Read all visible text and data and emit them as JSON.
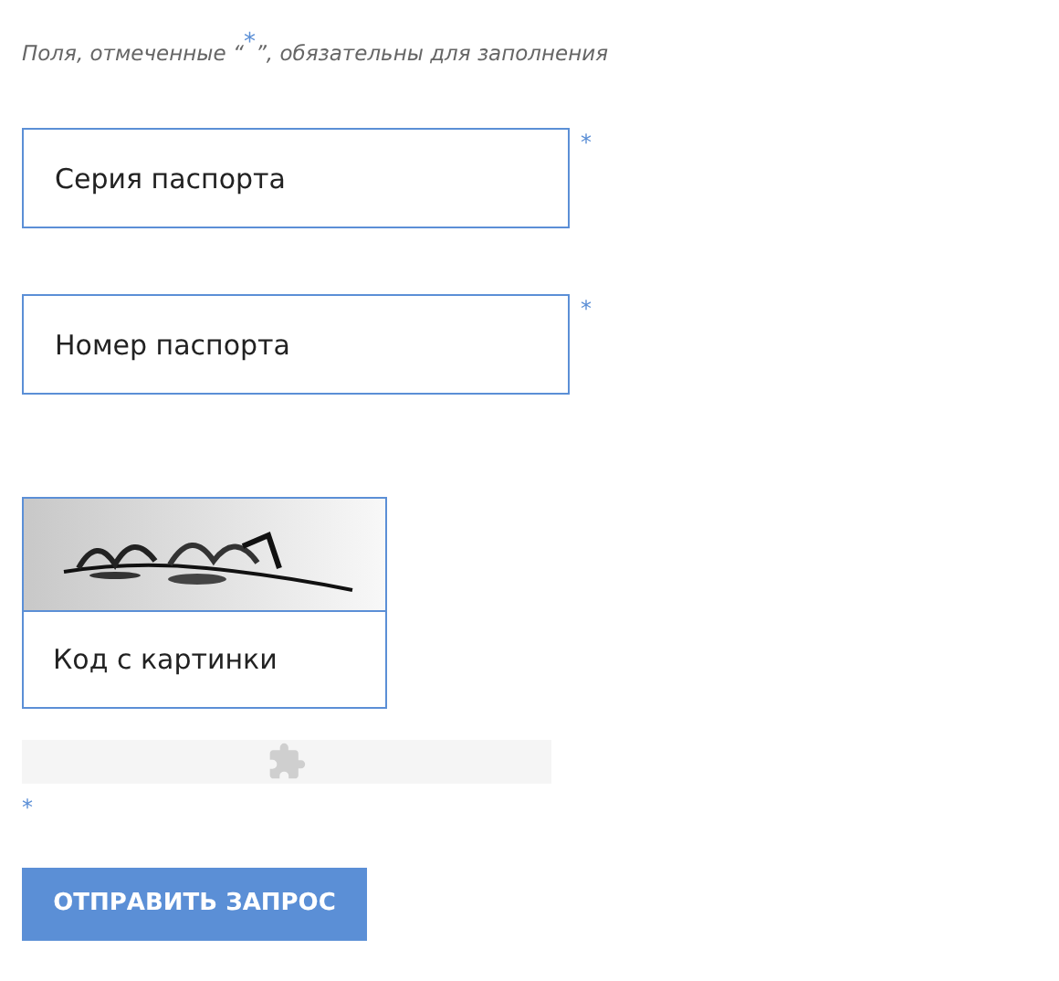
{
  "note": {
    "before": "Поля, отмеченные “",
    "mark": "*",
    "after": "”, обязательны для заполнения"
  },
  "fields": [
    {
      "placeholder": "Серия паспорта",
      "required_mark": "*"
    },
    {
      "placeholder": "Номер паспорта",
      "required_mark": "*"
    }
  ],
  "captcha": {
    "placeholder": "Код с картинки"
  },
  "puzzle_widget": {
    "required_mark": "*"
  },
  "submit_button": {
    "label": "ОТПРАВИТЬ ЗАПРОС"
  }
}
